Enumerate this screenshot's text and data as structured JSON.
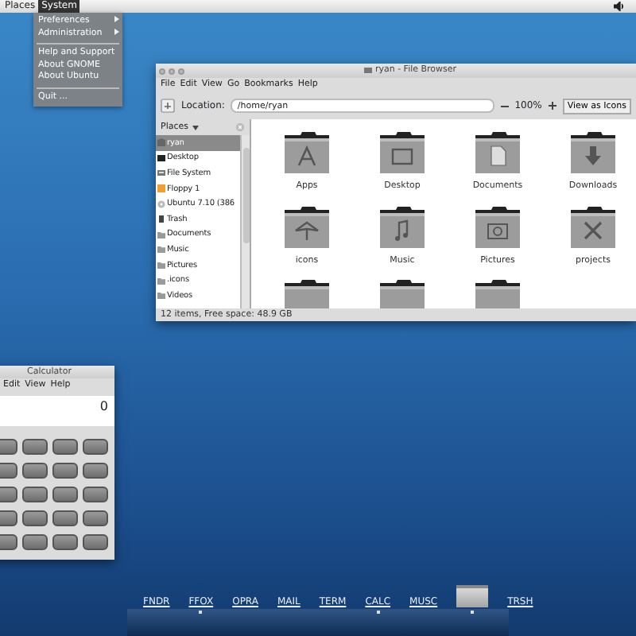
{
  "top_panel": {
    "menus": [
      {
        "label": "Places",
        "selected": false
      },
      {
        "label": "System",
        "selected": true
      }
    ]
  },
  "system_menu": {
    "items": [
      {
        "kind": "submenu",
        "label": "Preferences"
      },
      {
        "kind": "submenu",
        "label": "Administration"
      },
      {
        "kind": "separator"
      },
      {
        "kind": "item",
        "label": "Help and Support"
      },
      {
        "kind": "item",
        "label": "About GNOME"
      },
      {
        "kind": "item",
        "label": "About Ubuntu"
      },
      {
        "kind": "separator"
      },
      {
        "kind": "item",
        "label": "Quit ..."
      }
    ]
  },
  "file_browser": {
    "title": "ryan - File Browser",
    "menu": [
      "File",
      "Edit",
      "View",
      "Go",
      "Bookmarks",
      "Help"
    ],
    "location_label": "Location:",
    "location": "/home/ryan",
    "zoom": "100%",
    "view_mode": "View as Icons",
    "sidebar": {
      "header": "Places",
      "items": [
        {
          "label": "ryan",
          "kind": "home",
          "selected": true
        },
        {
          "label": "Desktop",
          "kind": "desktop",
          "selected": false
        },
        {
          "label": "File System",
          "kind": "drive",
          "selected": false
        },
        {
          "label": "Floppy 1",
          "kind": "floppy",
          "selected": false
        },
        {
          "label": "Ubuntu 7.10 (386",
          "kind": "disc",
          "selected": false
        },
        {
          "label": "Trash",
          "kind": "trash",
          "selected": false
        },
        {
          "label": "Documents",
          "kind": "folder",
          "selected": false
        },
        {
          "label": "Music",
          "kind": "folder",
          "selected": false
        },
        {
          "label": "Pictures",
          "kind": "folder",
          "selected": false
        },
        {
          "label": ".icons",
          "kind": "folder",
          "selected": false
        },
        {
          "label": "Videos",
          "kind": "folder",
          "selected": false
        }
      ]
    },
    "files": [
      {
        "label": "Apps",
        "kind": "apps"
      },
      {
        "label": "Desktop",
        "kind": "desktop"
      },
      {
        "label": "Documents",
        "kind": "documents"
      },
      {
        "label": "Downloads",
        "kind": "downloads"
      },
      {
        "label": "icons",
        "kind": "images"
      },
      {
        "label": "Music",
        "kind": "music"
      },
      {
        "label": "Pictures",
        "kind": "pictures"
      },
      {
        "label": "projects",
        "kind": "tools"
      },
      {
        "kind": "cut"
      },
      {
        "kind": "cut"
      },
      {
        "kind": "cut"
      }
    ],
    "status": "12 items, Free space: 48.9 GB"
  },
  "calculator": {
    "title": "Calculator",
    "menu": [
      "Edit",
      "View",
      "Help"
    ],
    "display": "0"
  },
  "dock": {
    "items": [
      {
        "kind": "label",
        "label": "FNDR",
        "running": false
      },
      {
        "kind": "label",
        "label": "FFOX",
        "running": true
      },
      {
        "kind": "label",
        "label": "OPRA",
        "running": false
      },
      {
        "kind": "label",
        "label": "MAIL",
        "running": false
      },
      {
        "kind": "label",
        "label": "TERM",
        "running": false
      },
      {
        "kind": "label",
        "label": "CALC",
        "running": true
      },
      {
        "kind": "label",
        "label": "MUSC",
        "running": false
      },
      {
        "kind": "thumbnail",
        "running": true
      },
      {
        "kind": "label",
        "label": "TRSH",
        "running": false
      }
    ]
  }
}
